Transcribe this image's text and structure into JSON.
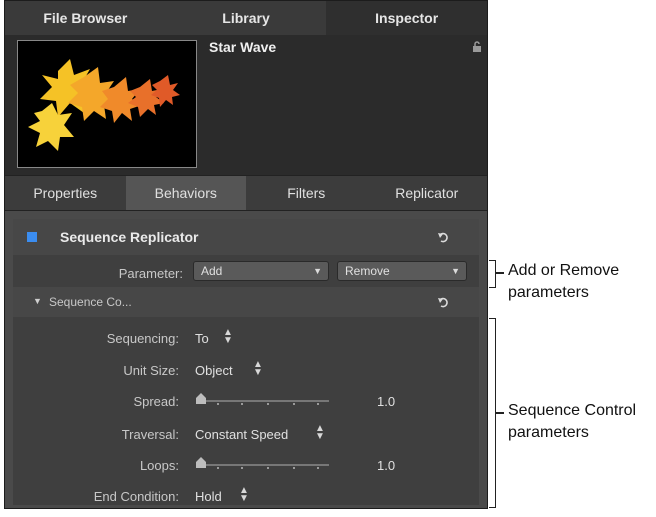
{
  "top_tabs": [
    "File Browser",
    "Library",
    "Inspector"
  ],
  "header": {
    "title": "Star Wave"
  },
  "sub_tabs": [
    "Properties",
    "Behaviors",
    "Filters",
    "Replicator"
  ],
  "behavior": {
    "title": "Sequence Replicator",
    "parameter_label": "Parameter:",
    "add_value": "Add",
    "remove_value": "Remove",
    "subsection_label": "Sequence Co...",
    "rows": {
      "sequencing": {
        "label": "Sequencing:",
        "value": "To"
      },
      "unit_size": {
        "label": "Unit Size:",
        "value": "Object"
      },
      "spread": {
        "label": "Spread:",
        "value": "1.0"
      },
      "traversal": {
        "label": "Traversal:",
        "value": "Constant Speed"
      },
      "loops": {
        "label": "Loops:",
        "value": "1.0"
      },
      "end_condition": {
        "label": "End Condition:",
        "value": "Hold"
      }
    }
  },
  "annotations": {
    "add_remove_line1": "Add or Remove",
    "add_remove_line2": "parameters",
    "seq_control_line1": "Sequence Control",
    "seq_control_line2": "parameters"
  },
  "colors": {
    "checkbox_blue": "#3b8df0",
    "panel_bg": "#4a4a4a"
  }
}
